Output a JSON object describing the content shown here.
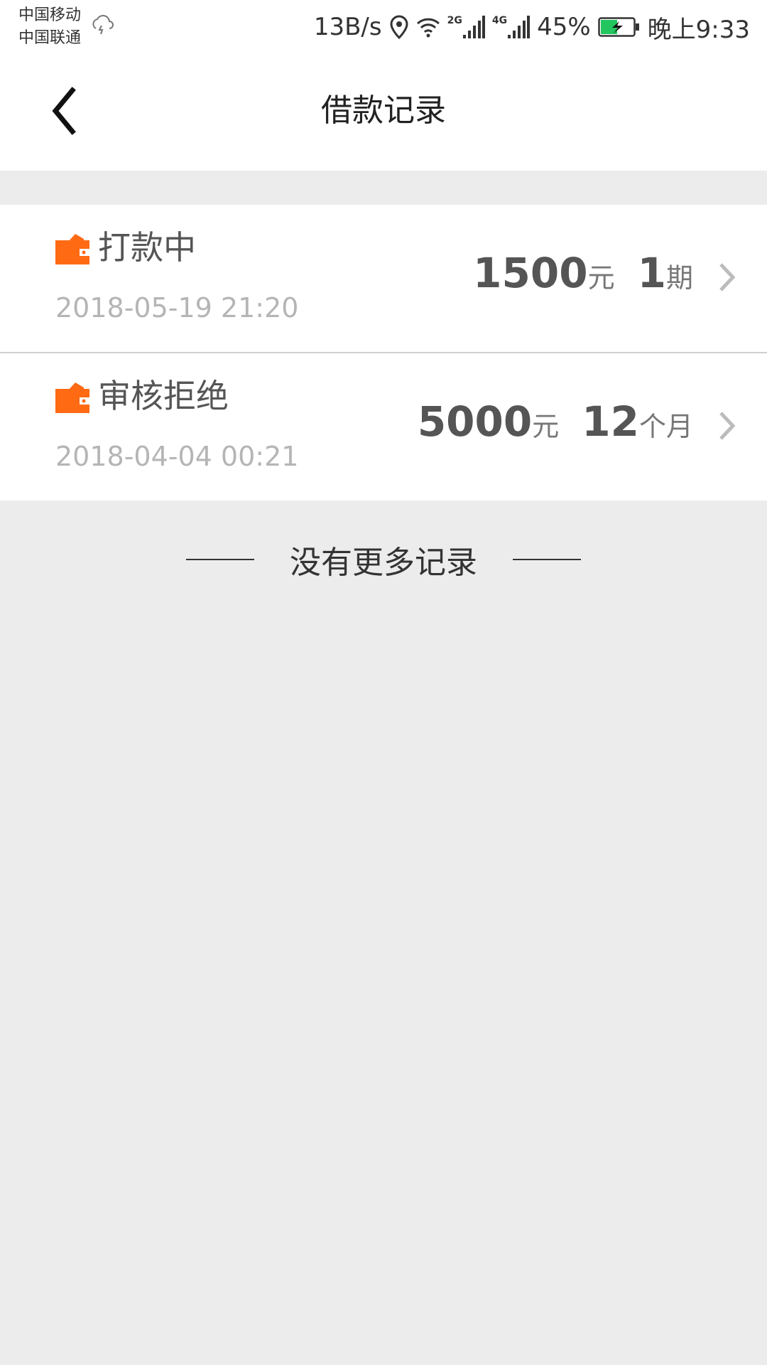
{
  "status_bar": {
    "carrier_1": "中国移动",
    "carrier_2": "中国联通",
    "speed": "13B/s",
    "net_2g": "2G",
    "net_4g": "4G",
    "battery": "45%",
    "time": "晚上9:33"
  },
  "header": {
    "title": "借款记录"
  },
  "records": [
    {
      "status": "打款中",
      "date": "2018-05-19 21:20",
      "amount": "1500",
      "amount_unit": "元",
      "term": "1",
      "term_unit": "期"
    },
    {
      "status": "审核拒绝",
      "date": "2018-04-04 00:21",
      "amount": "5000",
      "amount_unit": "元",
      "term": "12",
      "term_unit": "个月"
    }
  ],
  "footer": {
    "no_more": "没有更多记录"
  },
  "colors": {
    "accent": "#ff6a13",
    "background": "#ececec",
    "card": "#ffffff"
  }
}
